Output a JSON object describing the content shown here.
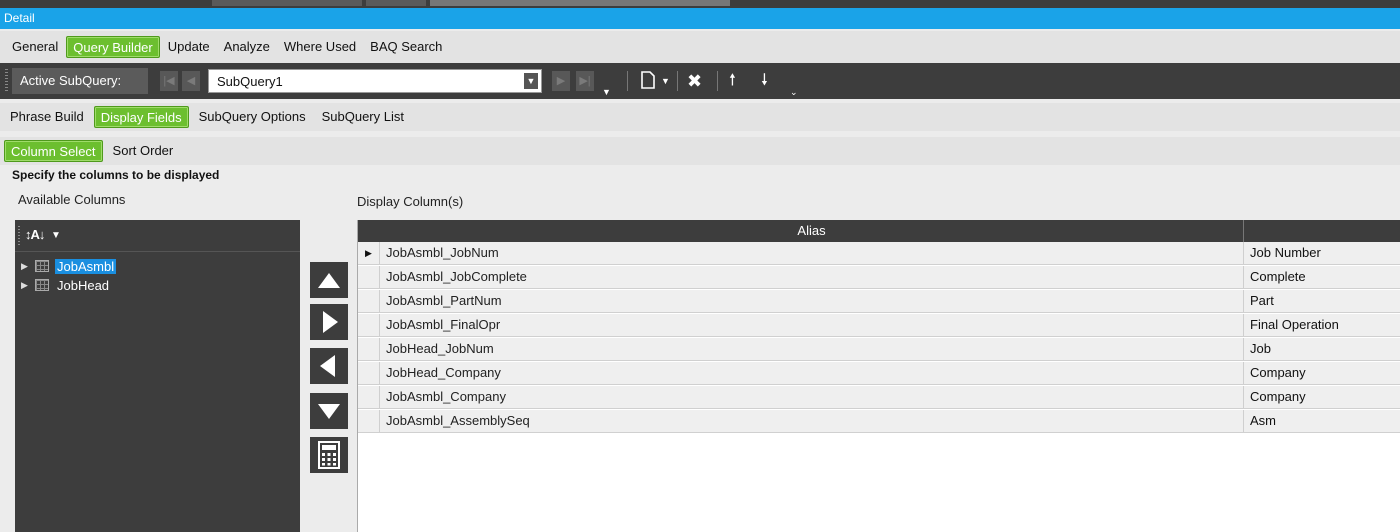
{
  "window": {
    "title": "Detail"
  },
  "main_tabs": [
    {
      "label": "General",
      "active": false
    },
    {
      "label": "Query Builder",
      "active": true
    },
    {
      "label": "Update",
      "active": false
    },
    {
      "label": "Analyze",
      "active": false
    },
    {
      "label": "Where Used",
      "active": false
    },
    {
      "label": "BAQ Search",
      "active": false
    }
  ],
  "subquery_toolbar": {
    "label": "Active SubQuery:",
    "selected": "SubQuery1",
    "icons": [
      "first-icon",
      "prev-icon",
      "next-icon",
      "last-icon",
      "new-icon",
      "delete-icon",
      "move-up-icon",
      "move-down-icon"
    ]
  },
  "sub_tabs": [
    {
      "label": "Phrase Build",
      "active": false
    },
    {
      "label": "Display Fields",
      "active": true
    },
    {
      "label": "SubQuery Options",
      "active": false
    },
    {
      "label": "SubQuery List",
      "active": false
    }
  ],
  "inner_tabs": [
    {
      "label": "Column Select",
      "active": true
    },
    {
      "label": "Sort Order",
      "active": false
    }
  ],
  "instructions": "Specify the columns to be displayed",
  "available": {
    "label": "Available Columns",
    "sort_icon": "sort-az-icon",
    "tables": [
      {
        "name": "JobAsmbl",
        "selected": true
      },
      {
        "name": "JobHead",
        "selected": false
      }
    ]
  },
  "move_buttons": [
    "move-up-icon",
    "add-right-icon",
    "remove-left-icon",
    "move-down-icon",
    "calculator-icon"
  ],
  "display": {
    "label": "Display Column(s)",
    "header": {
      "alias": "Alias",
      "label": ""
    },
    "rows": [
      {
        "alias": "JobAsmbl_JobNum",
        "label": "Job Number",
        "current": true
      },
      {
        "alias": "JobAsmbl_JobComplete",
        "label": "Complete",
        "current": false
      },
      {
        "alias": "JobAsmbl_PartNum",
        "label": "Part",
        "current": false
      },
      {
        "alias": "JobAsmbl_FinalOpr",
        "label": "Final Operation",
        "current": false
      },
      {
        "alias": "JobHead_JobNum",
        "label": "Job",
        "current": false
      },
      {
        "alias": "JobHead_Company",
        "label": "Company",
        "current": false
      },
      {
        "alias": "JobAsmbl_Company",
        "label": "Company",
        "current": false
      },
      {
        "alias": "JobAsmbl_AssemblySeq",
        "label": "Asm",
        "current": false
      }
    ]
  },
  "colors": {
    "accent": "#6cbf2f",
    "title_bar": "#1aa3e8",
    "dark": "#3d3d3d",
    "selection": "#1a8fe0"
  }
}
